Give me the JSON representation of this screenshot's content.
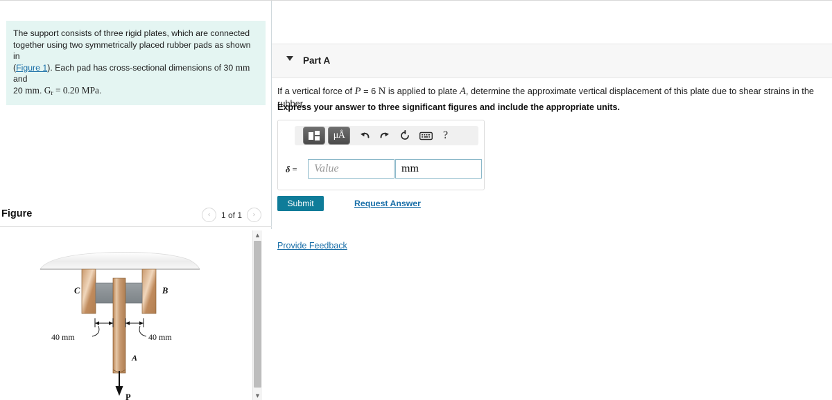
{
  "problem": {
    "line1": "The support consists of three rigid plates, which are connected",
    "line2": "together using two symmetrically placed rubber pads as shown in",
    "line3_pre": "(",
    "figure_link": "Figure 1",
    "line3_post": "). Each pad has cross-sectional dimensions of 30 ",
    "unit_mm_a": "mm",
    "line3_end": " and",
    "line4_pre": "20 ",
    "unit_mm_b": "mm",
    "line4_mid": ". ",
    "shear_symbol": "G",
    "shear_sub": "r",
    "shear_value": " = 0.20 ",
    "shear_unit": "MPa",
    "period": "."
  },
  "figure": {
    "title": "Figure",
    "prev_label": "‹",
    "next_label": "›",
    "count": "1 of 1",
    "labels": {
      "plate_c": "C",
      "plate_b": "B",
      "plate_a": "A",
      "force": "P",
      "dim_left": "40 mm",
      "dim_right": "40 mm"
    },
    "colors": {
      "plate": "#c8976a",
      "plate_light": "#e8c9a8",
      "rubber": "#8d9296",
      "ground": "#e9e9e9"
    }
  },
  "part": {
    "title": "Part A",
    "question_pre": "If a vertical force of ",
    "question_P": "P",
    "question_eq": " = 6 ",
    "question_N": "N",
    "question_mid": " is applied to plate ",
    "question_A": "A",
    "question_post": ", determine the approximate vertical displacement of this plate due to shear strains in the rubber.",
    "instruction": "Express your answer to three significant figures and include the appropriate units."
  },
  "answer": {
    "delta_label": "δ",
    "equals": " =",
    "value_placeholder": "Value",
    "unit_value": "mm",
    "toolbar": {
      "template_icon": "template-icon",
      "units_label": "μÅ",
      "undo_icon": "undo-icon",
      "redo_icon": "redo-icon",
      "reset_icon": "reset-icon",
      "keyboard_icon": "keyboard-icon",
      "help_label": "?"
    }
  },
  "actions": {
    "submit": "Submit",
    "request_answer": "Request Answer",
    "provide_feedback": "Provide Feedback"
  },
  "theme": {
    "accent": "#0f7c99",
    "link": "#1a6fa8",
    "problem_bg": "#e4f5f2"
  }
}
